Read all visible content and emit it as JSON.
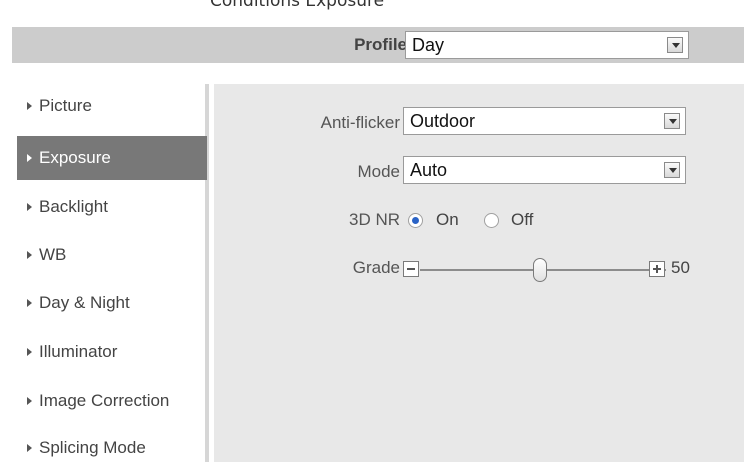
{
  "header": {
    "top_text": "Conditions Exposure"
  },
  "profile": {
    "label": "Profile",
    "value": "Day"
  },
  "sidebar": {
    "items": [
      {
        "label": "Picture",
        "active": false
      },
      {
        "label": "Exposure",
        "active": true
      },
      {
        "label": "Backlight",
        "active": false
      },
      {
        "label": "WB",
        "active": false
      },
      {
        "label": "Day & Night",
        "active": false
      },
      {
        "label": "Illuminator",
        "active": false
      },
      {
        "label": "Image Correction",
        "active": false
      },
      {
        "label": "Splicing Mode",
        "active": false
      }
    ]
  },
  "settings": {
    "anti_flicker": {
      "label": "Anti-flicker",
      "value": "Outdoor"
    },
    "mode": {
      "label": "Mode",
      "value": "Auto"
    },
    "nr3d": {
      "label": "3D NR",
      "on_label": "On",
      "off_label": "Off",
      "selected": "On"
    },
    "grade": {
      "label": "Grade",
      "value": "50",
      "min": 0,
      "max": 100
    }
  },
  "colors": {
    "active_nav": "#787878",
    "profile_bar": "#cccccc",
    "content_bg": "#e8e8e8",
    "radio_accent": "#2a63c6"
  }
}
